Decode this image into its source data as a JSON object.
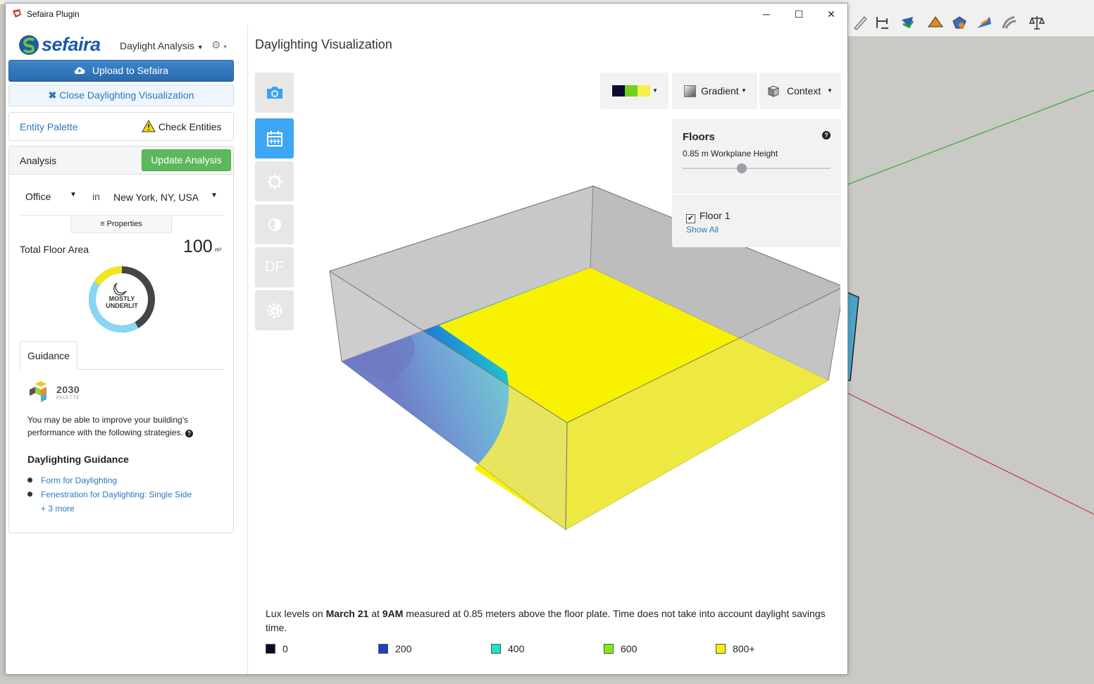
{
  "window": {
    "title": "Sefaira Plugin",
    "minimize": "─",
    "maximize": "☐",
    "close": "✕"
  },
  "left": {
    "logo_text": "sefaira",
    "mode": "Daylight Analysis",
    "upload_label": "Upload to Sefaira",
    "close_viz_label": "Close Daylighting Visualization",
    "entity_palette": "Entity Palette",
    "check_entities": "Check Entities",
    "analysis_title": "Analysis",
    "update_label": "Update Analysis",
    "building_type": "Office",
    "in_label": "in",
    "location": "New York, NY, USA",
    "properties_label": "Properties",
    "total_floor_area_label": "Total Floor Area",
    "total_floor_area_value": "100",
    "total_floor_area_unit": "m²",
    "donut_line1": "MOSTLY",
    "donut_line2": "UNDERLIT",
    "guidance_tab": "Guidance",
    "palette_title": "2030",
    "palette_sub": "PALETTE",
    "guidance_text": "You may be able to improve your building's performance with the following strategies.",
    "daylighting_guidance_title": "Daylighting Guidance",
    "guidance_items": [
      "Form for Daylighting",
      "Fenestration for Daylighting: Single Side"
    ],
    "more_link": "+ 3 more"
  },
  "right": {
    "title": "Daylighting Visualization",
    "gradient_label": "Gradient",
    "context_label": "Context",
    "floors_title": "Floors",
    "floors_help": "?",
    "workplane_height": "0.85 m Workplane Height",
    "slider_value": 0.4,
    "floor_name": "Floor 1",
    "show_all": "Show All",
    "side_df_label": "DF",
    "lux_text": {
      "pre": "Lux levels on ",
      "date": "March 21",
      "at": " at ",
      "time": "9AM",
      "post": " measured at 0.85 meters above the floor plate. Time does not take into account daylight savings time."
    },
    "legend": [
      {
        "label": "0",
        "color": "#08082a"
      },
      {
        "label": "200",
        "color": "#1e3fc2"
      },
      {
        "label": "400",
        "color": "#1ee3c8"
      },
      {
        "label": "600",
        "color": "#7ef010"
      },
      {
        "label": "800+",
        "color": "#f6f200"
      }
    ]
  }
}
